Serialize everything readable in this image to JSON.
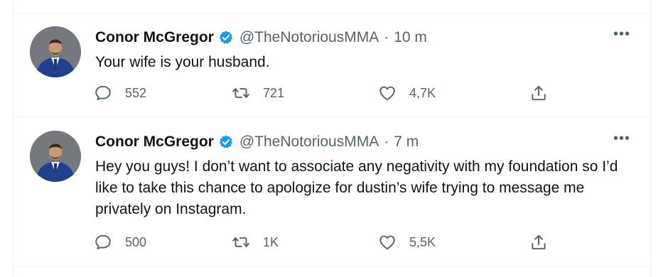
{
  "tweets": [
    {
      "name": "Conor McGregor",
      "handle": "@TheNotoriousMMA",
      "separator": "·",
      "time": "10 m",
      "text": "Your wife is your husband.",
      "replies": "552",
      "retweets": "721",
      "likes": "4,7K",
      "more": "•••"
    },
    {
      "name": "Conor McGregor",
      "handle": "@TheNotoriousMMA",
      "separator": "·",
      "time": "7 m",
      "text": "Hey you guys! I don’t want to associate any negativity with my foundation so I’d like to take this chance to apologize for dustin’s wife trying to message me privately on Instagram.",
      "replies": "500",
      "retweets": "1K",
      "likes": "5,5K",
      "more": "•••"
    }
  ],
  "colors": {
    "verified": "#1d9bf0",
    "secondary_text": "#536471",
    "primary_text": "#0f1419",
    "divider": "#eff3f4"
  },
  "icons": [
    "verified-badge-icon",
    "reply-icon",
    "retweet-icon",
    "like-icon",
    "share-icon",
    "more-icon"
  ]
}
